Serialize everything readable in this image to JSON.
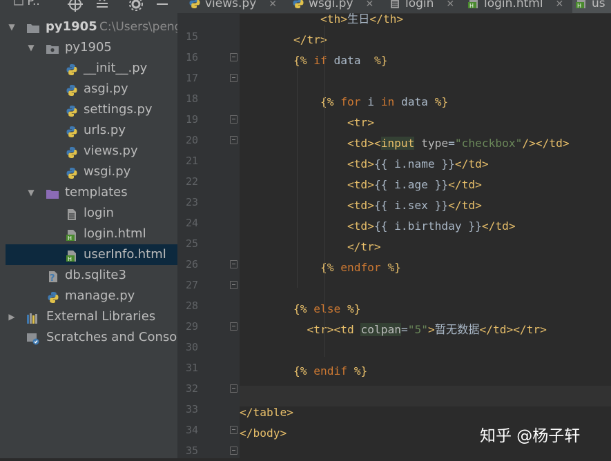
{
  "project_toolbar": {
    "project_label": "P..",
    "icons": [
      "target-icon",
      "collapse-icon",
      "gear-icon",
      "minimize-icon"
    ]
  },
  "tabs": [
    {
      "label": "views.py",
      "icon": "python-file-icon"
    },
    {
      "label": "wsgi.py",
      "icon": "python-file-icon"
    },
    {
      "label": "login",
      "icon": "text-file-icon"
    },
    {
      "label": "login.html",
      "icon": "html-file-icon"
    },
    {
      "label": "us",
      "icon": "html-file-icon",
      "active": true
    }
  ],
  "tree": [
    {
      "label": "py1905",
      "path": "C:\\Users\\peng",
      "icon": "folder-icon",
      "expanded": true
    },
    {
      "label": "py1905",
      "icon": "package-folder-icon",
      "expanded": true
    },
    {
      "label": "__init__.py",
      "icon": "python-file-icon"
    },
    {
      "label": "asgi.py",
      "icon": "python-file-icon"
    },
    {
      "label": "settings.py",
      "icon": "python-file-icon"
    },
    {
      "label": "urls.py",
      "icon": "python-file-icon"
    },
    {
      "label": "views.py",
      "icon": "python-file-icon"
    },
    {
      "label": "wsgi.py",
      "icon": "python-file-icon"
    },
    {
      "label": "templates",
      "icon": "templates-folder-icon",
      "expanded": true
    },
    {
      "label": "login",
      "icon": "text-file-icon"
    },
    {
      "label": "login.html",
      "icon": "html-file-icon"
    },
    {
      "label": "userInfo.html",
      "icon": "html-file-icon",
      "selected": true
    },
    {
      "label": "db.sqlite3",
      "icon": "unknown-file-icon"
    },
    {
      "label": "manage.py",
      "icon": "python-file-icon"
    },
    {
      "label": "External Libraries",
      "icon": "libraries-icon",
      "expanded": false
    },
    {
      "label": "Scratches and Consoles",
      "icon": "scratches-icon"
    }
  ],
  "code": [
    {
      "n": "15",
      "t": "            <th>生日</th>"
    },
    {
      "n": "16",
      "t": "        </tr>"
    },
    {
      "n": "17",
      "t": "        {% if data  %}"
    },
    {
      "n": "18",
      "t": ""
    },
    {
      "n": "19",
      "t": "            {% for i in data %}"
    },
    {
      "n": "20",
      "t": "                <tr>"
    },
    {
      "n": "21",
      "t": "                <td><input type=\"checkbox\"/></td>"
    },
    {
      "n": "22",
      "t": "                <td>{{ i.name }}</td>"
    },
    {
      "n": "23",
      "t": "                <td>{{ i.age }}</td>"
    },
    {
      "n": "24",
      "t": "                <td>{{ i.sex }}</td>"
    },
    {
      "n": "25",
      "t": "                <td>{{ i.birthday }}</td>"
    },
    {
      "n": "26",
      "t": "                </tr>"
    },
    {
      "n": "27",
      "t": "            {% endfor %}"
    },
    {
      "n": "28",
      "t": ""
    },
    {
      "n": "29",
      "t": "        {% else %}"
    },
    {
      "n": "30",
      "t": "          <tr><td colpan=\"5\">暂无数据</td></tr>"
    },
    {
      "n": "31",
      "t": ""
    },
    {
      "n": "32",
      "t": "        {% endif %}"
    },
    {
      "n": "33",
      "t": ""
    },
    {
      "n": "34",
      "t": "</table>"
    },
    {
      "n": "35",
      "t": "</body>"
    }
  ],
  "watermark": "知乎 @杨子轩",
  "colors": {
    "tag": "#e8bf6a",
    "string": "#6a8759",
    "keyword": "#cc7832",
    "selection": "#0d293e"
  }
}
